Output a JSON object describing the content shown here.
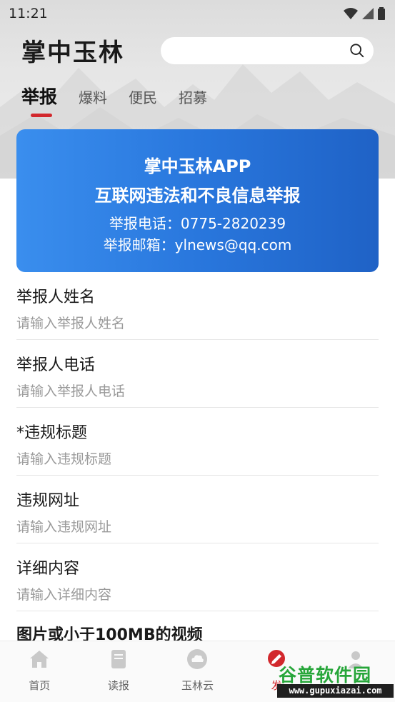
{
  "status": {
    "time": "11:21"
  },
  "header": {
    "logo_text": "掌中玉林",
    "search": {
      "placeholder": "",
      "value": ""
    }
  },
  "tabs": [
    {
      "label": "举报",
      "active": true
    },
    {
      "label": "爆料",
      "active": false
    },
    {
      "label": "便民",
      "active": false
    },
    {
      "label": "招募",
      "active": false
    }
  ],
  "banner": {
    "line1": "掌中玉林APP",
    "line2": "互联网违法和不良信息举报",
    "line3": "举报电话：0775-2820239",
    "line4": "举报邮箱：ylnews@qq.com"
  },
  "form": {
    "fields": [
      {
        "label": "举报人姓名",
        "placeholder": "请输入举报人姓名"
      },
      {
        "label": "举报人电话",
        "placeholder": "请输入举报人电话"
      },
      {
        "label": "*违规标题",
        "placeholder": "请输入违规标题"
      },
      {
        "label": "违规网址",
        "placeholder": "请输入违规网址"
      },
      {
        "label": "详细内容",
        "placeholder": "请输入详细内容"
      }
    ],
    "media_label": "图片或小于100MB的视频"
  },
  "bottom_nav": [
    {
      "label": "首页",
      "icon": "home-icon"
    },
    {
      "label": "读报",
      "icon": "newspaper-icon"
    },
    {
      "label": "玉林云",
      "icon": "cloud-icon"
    },
    {
      "label": "发",
      "icon": "publish-icon",
      "active": true
    },
    {
      "label": "",
      "icon": "user-icon"
    }
  ],
  "watermark": {
    "top": "谷普软件园",
    "bottom": "www.gupuxiazai.com"
  },
  "colors": {
    "accent": "#d2282d",
    "banner_start": "#3a8eee",
    "banner_end": "#1f62c6"
  }
}
